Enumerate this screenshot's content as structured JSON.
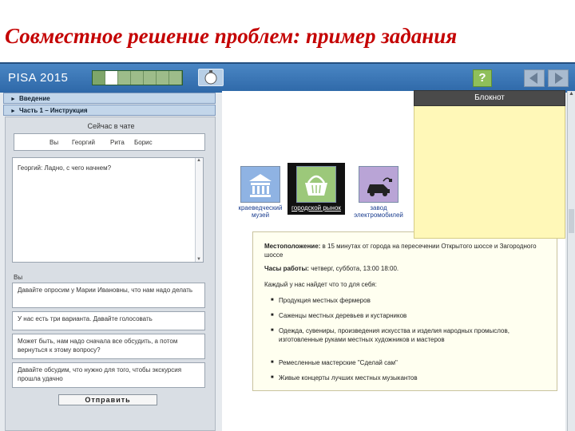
{
  "slide_title": "Совместное решение проблем: пример задания",
  "header": {
    "logo": "PISA 2015",
    "progress": {
      "segments": 7,
      "done": 1,
      "current_index": 1
    },
    "clock_icon": "clock-icon",
    "help_label": "?",
    "nav_back_icon": "arrow-left-icon",
    "nav_forward_icon": "arrow-right-icon"
  },
  "sections": [
    {
      "label": "Введение"
    },
    {
      "label": "Часть 1 – Инструкция"
    }
  ],
  "chat": {
    "title": "Сейчас в чате",
    "participants": [
      "Вы",
      "Георгий",
      "Рита",
      "Борис"
    ],
    "log": [
      {
        "speaker": "Георгий:",
        "text": "Ладно, с чего начнем?"
      }
    ],
    "you_label": "Вы",
    "options": [
      "Давайте опросим у Марии Ивановны, что нам надо делать",
      "У нас есть три варианта. Давайте голосовать",
      "Может быть, нам надо сначала все обсудить, а потом вернуться к этому вопросу?",
      "Давайте обсудим, что нужно для того, чтобы экскурсия прошла удачно"
    ],
    "send_label": "Отправить"
  },
  "places": [
    {
      "label": "краеведческий музей",
      "icon": "museum-icon",
      "color": "#8fb3e3",
      "selected": false
    },
    {
      "label": "городской рынок",
      "icon": "basket-icon",
      "color": "#9cc87a",
      "selected": true
    },
    {
      "label": "завод электромобилей",
      "icon": "electric-car-icon",
      "color": "#b9a4d6",
      "selected": false
    }
  ],
  "info": {
    "location_label": "Местоположение:",
    "location_text": "в 15 минутах от города на пересечении Открытого шоссе и Загородного шоссе",
    "hours_label": "Часы работы:",
    "hours_text": "четверг, суббота, 13:00 18:00.",
    "intro": "Каждый у нас найдет что то для себя:",
    "items": [
      "Продукция местных фермеров",
      "Саженцы местных деревьев и кустарников",
      "Одежда, сувениры, произведения искусства и изделия народных промыслов, изготовленные руками местных художников и мастеров",
      "Ремесленные мастерские \"Сделай сам\"",
      "Живые концерты лучших местных музыкантов"
    ]
  },
  "notepad": {
    "title": "Блокнот",
    "text": ""
  },
  "colors": {
    "title_red": "#c40000",
    "header_blue": "#2e68a8",
    "notepad_yellow": "#fff8b8",
    "help_green": "#8fbf5a"
  }
}
